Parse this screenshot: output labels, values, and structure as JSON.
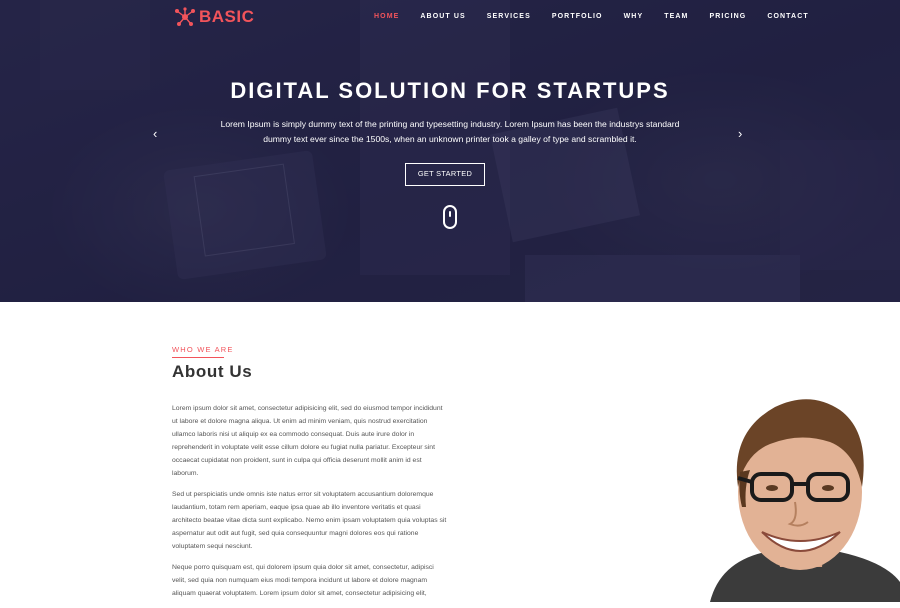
{
  "brand": {
    "name": "BASIC",
    "accent": "#f2545b"
  },
  "nav": {
    "items": [
      {
        "label": "HOME",
        "active": true
      },
      {
        "label": "ABOUT US",
        "active": false
      },
      {
        "label": "SERVICES",
        "active": false
      },
      {
        "label": "PORTFOLIO",
        "active": false
      },
      {
        "label": "WHY",
        "active": false
      },
      {
        "label": "TEAM",
        "active": false
      },
      {
        "label": "PRICING",
        "active": false
      },
      {
        "label": "CONTACT",
        "active": false
      }
    ]
  },
  "hero": {
    "title": "DIGITAL SOLUTION FOR STARTUPS",
    "subtitle": "Lorem Ipsum is simply dummy text of the printing and typesetting industry. Lorem Ipsum has been the industrys standard dummy text ever since the 1500s, when an unknown printer took a galley of type and scrambled it.",
    "cta_label": "GET STARTED",
    "prev_icon": "chevron-left-icon",
    "next_icon": "chevron-right-icon",
    "scroll_icon": "mouse-scroll-icon"
  },
  "about": {
    "kicker": "WHO WE ARE",
    "title": "About Us",
    "paragraphs": [
      "Lorem ipsum dolor sit amet, consectetur adipisicing elit, sed do eiusmod tempor incididunt ut labore et dolore magna aliqua. Ut enim ad minim veniam, quis nostrud exercitation ullamco laboris nisi ut aliquip ex ea commodo consequat. Duis aute irure dolor in reprehenderit in voluptate velit esse cillum dolore eu fugiat nulla pariatur. Excepteur sint occaecat cupidatat non proident, sunt in culpa qui officia deserunt mollit anim id est laborum.",
      "Sed ut perspiciatis unde omnis iste natus error sit voluptatem accusantium doloremque laudantium, totam rem aperiam, eaque ipsa quae ab illo inventore veritatis et quasi architecto beatae vitae dicta sunt explicabo. Nemo enim ipsam voluptatem quia voluptas sit aspernatur aut odit aut fugit, sed quia consequuntur magni dolores eos qui ratione voluptatem sequi nesciunt.",
      "Neque porro quisquam est, qui dolorem ipsum quia dolor sit amet, consectetur, adipisci velit, sed quia non numquam eius modi tempora incidunt ut labore et dolore magnam aliquam quaerat voluptatem. Lorem ipsum dolor sit amet, consectetur adipisicing elit,"
    ]
  }
}
